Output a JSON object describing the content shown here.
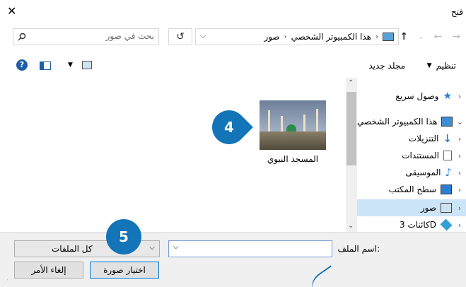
{
  "window": {
    "title": "فتح",
    "close_icon": "close-icon"
  },
  "address": {
    "crumbs": [
      "هذا الكمبيوتر الشخصي",
      "صور"
    ],
    "search_placeholder": "بحث في صور"
  },
  "toolbar": {
    "organize_label": "تنظيم",
    "new_folder_label": "مجلد جديد"
  },
  "content": {
    "items": [
      {
        "label": "المسجد النبوي"
      }
    ]
  },
  "sidebar": {
    "items": [
      {
        "label": "وصول سريع",
        "icon": "star-icon"
      },
      {
        "label": "هذا الكمبيوتر الشخصي",
        "icon": "computer-icon"
      },
      {
        "label": "التنزيلات",
        "icon": "download-icon"
      },
      {
        "label": "المستندات",
        "icon": "document-icon"
      },
      {
        "label": "الموسيقى",
        "icon": "music-icon"
      },
      {
        "label": "سطح المكتب",
        "icon": "desktop-icon"
      },
      {
        "label": "صور",
        "icon": "pictures-icon",
        "selected": true
      },
      {
        "label": "كائنات 3D",
        "icon": "cube-icon"
      }
    ]
  },
  "footer": {
    "filename_label": "اسم الملف:",
    "filename_value": "",
    "filter_value": "كل الملفات",
    "open_label": "اختيار صورة",
    "cancel_label": "إلغاء الأمر"
  },
  "callouts": {
    "step_a": "4",
    "step_b": "5"
  },
  "colors": {
    "accent": "#1474b8",
    "selected": "#cce4f7"
  }
}
